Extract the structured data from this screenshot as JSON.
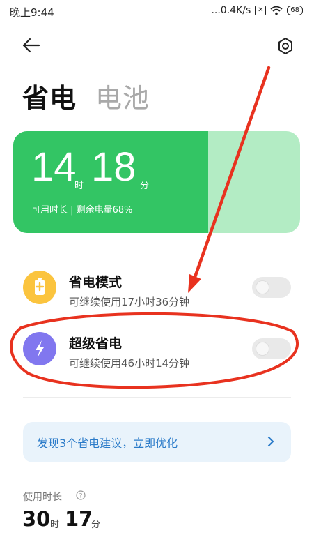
{
  "status_bar": {
    "time": "晚上9:44",
    "network_speed": "...0.4K/s",
    "sim_icon": "sim-x-icon",
    "wifi_icon": "wifi-icon",
    "battery_level": "68"
  },
  "header": {
    "back_icon": "back-arrow-icon",
    "settings_icon": "gear-icon",
    "title_active": "省电",
    "title_inactive": "电池"
  },
  "battery_card": {
    "hours": "14",
    "hours_unit": "时",
    "minutes": "18",
    "minutes_unit": "分",
    "subtitle": "可用时长 | 剩余电量68%",
    "charge_fraction": 0.68,
    "fill_color": "#33c564",
    "remain_color": "#b3ecc4"
  },
  "modes": [
    {
      "title": "省电模式",
      "desc": "可继续使用17小时36分钟",
      "icon": "battery-saver-icon",
      "icon_color": "#fbc43e",
      "enabled": false
    },
    {
      "title": "超级省电",
      "desc": "可继续使用46小时14分钟",
      "icon": "lightning-icon",
      "icon_color": "#8177ef",
      "enabled": false
    }
  ],
  "tip": {
    "text": "发现3个省电建议，立即优化",
    "icon": "chevron-right-icon"
  },
  "usage": {
    "label": "使用时长",
    "help_icon": "question-circle-icon",
    "hours": "30",
    "hours_unit": "时",
    "minutes": "17",
    "minutes_unit": "分"
  },
  "annotation": {
    "color": "#e8321f"
  }
}
